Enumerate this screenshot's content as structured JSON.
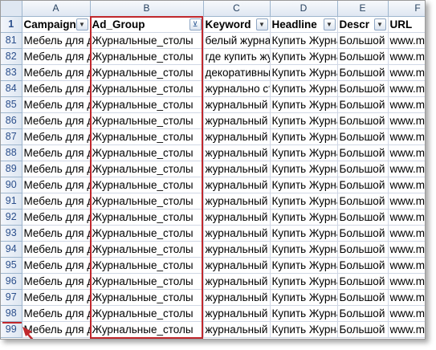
{
  "sheet": {
    "columns": [
      {
        "letter": "A",
        "header": "Campaign",
        "filter_active": false
      },
      {
        "letter": "B",
        "header": "Ad_Group",
        "filter_active": true
      },
      {
        "letter": "C",
        "header": "Keyword",
        "filter_active": false
      },
      {
        "letter": "D",
        "header": "Headline",
        "filter_active": false
      },
      {
        "letter": "E",
        "header": "Descr",
        "filter_active": false
      },
      {
        "letter": "F",
        "header": "URL",
        "filter_active": false
      }
    ],
    "header_row_number": "1",
    "filter_arrow": "▼",
    "filter_active_glyph": "⊻",
    "rows": [
      {
        "num": "81",
        "cells": [
          "Мебель для дома",
          "Журнальные_столы",
          "белый журнальный",
          "Купить Журнальный",
          "Большой",
          "www.m"
        ]
      },
      {
        "num": "82",
        "cells": [
          "Мебель для дома",
          "Журнальные_столы",
          "где купить журнальный",
          "Купить Журнальный",
          "Большой",
          "www.m"
        ]
      },
      {
        "num": "83",
        "cells": [
          "Мебель для дома",
          "Журнальные_столы",
          "декоративный",
          "Купить Журнальный",
          "Большой",
          "www.m"
        ]
      },
      {
        "num": "84",
        "cells": [
          "Мебель для дома",
          "Журнальные_столы",
          "журнально стол",
          "Купить Журнальный",
          "Большой",
          "www.m"
        ]
      },
      {
        "num": "85",
        "cells": [
          "Мебель для дома",
          "Журнальные_столы",
          "журнальный",
          "Купить Журнальный",
          "Большой",
          "www.m"
        ]
      },
      {
        "num": "86",
        "cells": [
          "Мебель для дома",
          "Журнальные_столы",
          "журнальный",
          "Купить Журнальный",
          "Большой",
          "www.m"
        ]
      },
      {
        "num": "87",
        "cells": [
          "Мебель для дома",
          "Журнальные_столы",
          "журнальный",
          "Купить Журнальный",
          "Большой",
          "www.m"
        ]
      },
      {
        "num": "88",
        "cells": [
          "Мебель для дома",
          "Журнальные_столы",
          "журнальный",
          "Купить Журнальный",
          "Большой",
          "www.m"
        ]
      },
      {
        "num": "89",
        "cells": [
          "Мебель для дома",
          "Журнальные_столы",
          "журнальный",
          "Купить Журнальный",
          "Большой",
          "www.m"
        ]
      },
      {
        "num": "90",
        "cells": [
          "Мебель для дома",
          "Журнальные_столы",
          "журнальный",
          "Купить Журнальный",
          "Большой",
          "www.m"
        ]
      },
      {
        "num": "91",
        "cells": [
          "Мебель для дома",
          "Журнальные_столы",
          "журнальный",
          "Купить Журнальный",
          "Большой",
          "www.m"
        ]
      },
      {
        "num": "92",
        "cells": [
          "Мебель для дома",
          "Журнальные_столы",
          "журнальный",
          "Купить Журнальный",
          "Большой",
          "www.m"
        ]
      },
      {
        "num": "93",
        "cells": [
          "Мебель для дома",
          "Журнальные_столы",
          "журнальный",
          "Купить Журнальный",
          "Большой",
          "www.m"
        ]
      },
      {
        "num": "94",
        "cells": [
          "Мебель для дома",
          "Журнальные_столы",
          "журнальный",
          "Купить Журнальный",
          "Большой",
          "www.m"
        ]
      },
      {
        "num": "95",
        "cells": [
          "Мебель для дома",
          "Журнальные_столы",
          "журнальный",
          "Купить Журнальный",
          "Большой",
          "www.m"
        ]
      },
      {
        "num": "96",
        "cells": [
          "Мебель для дома",
          "Журнальные_столы",
          "журнальный",
          "Купить Журнальный",
          "Большой",
          "www.m"
        ]
      },
      {
        "num": "97",
        "cells": [
          "Мебель для дома",
          "Журнальные_столы",
          "журнальный",
          "Купить Журнальный",
          "Большой",
          "www.m"
        ]
      },
      {
        "num": "98",
        "cells": [
          "Мебель для дома",
          "Журнальные_столы",
          "журнальный",
          "Купить Журнальный",
          "Большой",
          "www.m"
        ]
      },
      {
        "num": "99",
        "cells": [
          "Мебель для дома",
          "Журнальные_столы",
          "журнальный",
          "Купить Журнальный",
          "Большой",
          "www.m"
        ]
      }
    ]
  },
  "colors": {
    "highlight_border": "#c0282d",
    "row_header_text": "#2b4f8c",
    "grid_line": "#d0d7e5"
  }
}
